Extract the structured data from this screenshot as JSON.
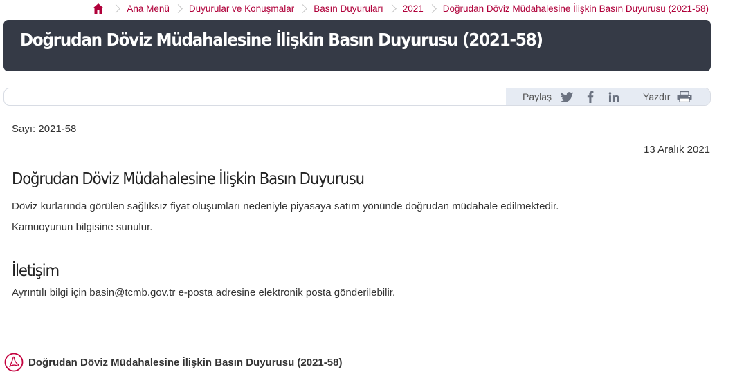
{
  "breadcrumb": {
    "home_icon": "home-icon",
    "items": [
      "Ana Menü",
      "Duyurular ve Konuşmalar",
      "Basın Duyuruları",
      "2021"
    ],
    "current": "Doğrudan Döviz Müdahalesine İlişkin Basın Duyurusu (2021-58)"
  },
  "page": {
    "title": "Doğrudan Döviz Müdahalesine İlişkin Basın Duyurusu (2021-58)"
  },
  "tools": {
    "share_label": "Paylaş",
    "share_icons": [
      "twitter-icon",
      "facebook-icon",
      "linkedin-icon"
    ],
    "print_label": "Yazdır",
    "print_icon": "printer-icon"
  },
  "announcement": {
    "number": "Sayı: 2021-58",
    "date": "13 Aralık 2021",
    "heading": "Doğrudan Döviz Müdahalesine İlişkin Basın Duyurusu",
    "paragraphs": [
      "Döviz kurlarında görülen sağlıksız fiyat oluşumları nedeniyle piyasaya satım yönünde doğrudan müdahale edilmektedir.",
      "Kamuoyunun bilgisine sunulur."
    ]
  },
  "contact": {
    "heading": "İletişim",
    "text": "Ayrıntılı bilgi için basin@tcmb.gov.tr e-posta adresine elektronik posta gönderilebilir."
  },
  "attachment": {
    "icon": "pdf-icon",
    "label": "Doğrudan Döviz Müdahalesine İlişkin Basın Duyurusu (2021-58)"
  },
  "colors": {
    "accent": "#b0003a",
    "banner": "#353a46",
    "toolbar": "#e6ebf3"
  }
}
